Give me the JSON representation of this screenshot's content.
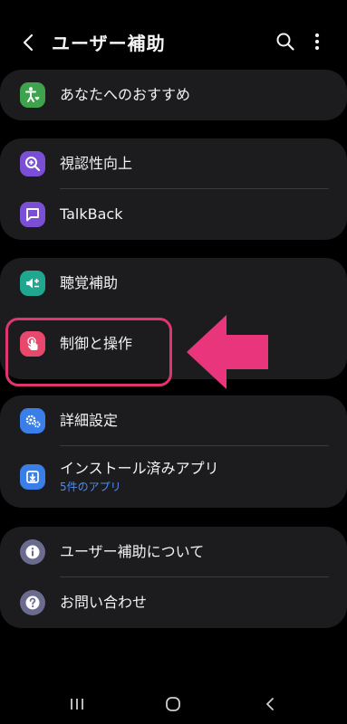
{
  "header": {
    "title": "ユーザー補助"
  },
  "sections": {
    "recommend": {
      "label": "あなたへのおすすめ",
      "icon": "accessibility-person-icon",
      "color": "#3fa34d"
    },
    "visibility": {
      "label": "視認性向上",
      "icon": "magnifier-plus-icon",
      "color": "#7a4fd6"
    },
    "talkback": {
      "label": "TalkBack",
      "icon": "speech-bubble-icon",
      "color": "#7a4fd6"
    },
    "hearing": {
      "label": "聴覚補助",
      "icon": "speaker-plus-icon",
      "color": "#1fa88f"
    },
    "interaction": {
      "label": "制御と操作",
      "icon": "touch-hand-icon",
      "color": "#e8486c"
    },
    "advanced": {
      "label": "詳細設定",
      "icon": "gears-icon",
      "color": "#3a7ee8"
    },
    "installed": {
      "label": "インストール済みアプリ",
      "sub": "5件のアプリ",
      "icon": "download-icon",
      "color": "#3a7ee8"
    },
    "about": {
      "label": "ユーザー補助について",
      "icon": "info-icon",
      "color": "#6b6b8e"
    },
    "contact": {
      "label": "お問い合わせ",
      "icon": "question-icon",
      "color": "#6b6b8e"
    }
  },
  "annotation": {
    "highlight_color": "#e0356f",
    "arrow_color": "#e8357b"
  },
  "navbar": {
    "recent": "recent-apps-icon",
    "home": "home-icon",
    "back": "back-icon"
  }
}
